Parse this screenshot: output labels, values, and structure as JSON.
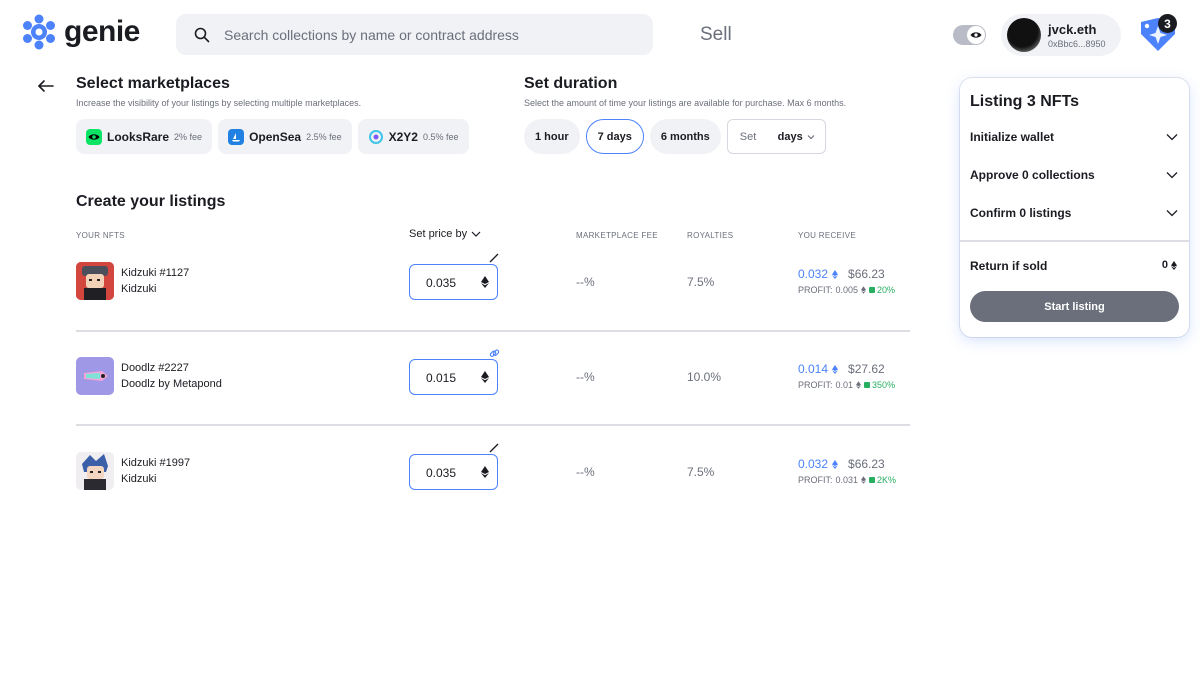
{
  "header": {
    "logo_text": "genie",
    "search_placeholder": "Search collections by name or contract address",
    "nav_sell": "Sell",
    "account_name": "jvck.eth",
    "account_address": "0xBbc6...8950",
    "bag_count": "3"
  },
  "marketplaces": {
    "title": "Select marketplaces",
    "subtitle": "Increase the visibility of your listings by selecting multiple marketplaces.",
    "items": [
      {
        "name": "LooksRare",
        "fee": "2% fee",
        "icon": "looksrare-icon",
        "color": "#0ce466"
      },
      {
        "name": "OpenSea",
        "fee": "2.5% fee",
        "icon": "opensea-icon",
        "color": "#2081e2"
      },
      {
        "name": "X2Y2",
        "fee": "0.5% fee",
        "icon": "x2y2-icon",
        "color": "#3ec5e8"
      }
    ]
  },
  "duration": {
    "title": "Set duration",
    "subtitle": "Select the amount of time your listings are available for purchase. Max 6 months.",
    "options": [
      "1 hour",
      "7 days",
      "6 months"
    ],
    "selected": "7 days",
    "custom_placeholder": "Set",
    "custom_unit": "days"
  },
  "listings": {
    "title": "Create your listings",
    "columns": {
      "nfts": "YOUR NFTS",
      "price": "Set price by",
      "fee": "MARKETPLACE FEE",
      "royalties": "ROYALTIES",
      "receive": "YOU RECEIVE"
    },
    "rows": [
      {
        "name": "Kidzuki #1127",
        "collection": "Kidzuki",
        "price": "0.035",
        "fee": "--%",
        "royalties": "7.5%",
        "receive_eth": "0.032",
        "receive_usd": "$66.23",
        "profit_label": "PROFIT:",
        "profit_eth": "0.005",
        "profit_pct": "20%",
        "edit_icon": "pencil-icon"
      },
      {
        "name": "Doodlz #2227",
        "collection": "Doodlz by Metapond",
        "price": "0.015",
        "fee": "--%",
        "royalties": "10.0%",
        "receive_eth": "0.014",
        "receive_usd": "$27.62",
        "profit_label": "PROFIT:",
        "profit_eth": "0.01",
        "profit_pct": "350%",
        "edit_icon": "link-icon"
      },
      {
        "name": "Kidzuki #1997",
        "collection": "Kidzuki",
        "price": "0.035",
        "fee": "--%",
        "royalties": "7.5%",
        "receive_eth": "0.032",
        "receive_usd": "$66.23",
        "profit_label": "PROFIT:",
        "profit_eth": "0.031",
        "profit_pct": "2K%",
        "edit_icon": "pencil-icon"
      }
    ]
  },
  "panel": {
    "title": "Listing 3 NFTs",
    "steps": [
      "Initialize wallet",
      "Approve 0 collections",
      "Confirm 0 listings"
    ],
    "return_label": "Return if sold",
    "return_value": "0",
    "start_button": "Start listing"
  },
  "colors": {
    "accent": "#4c82fb",
    "profit_green": "#27ae60",
    "muted": "#6b6f7b"
  }
}
